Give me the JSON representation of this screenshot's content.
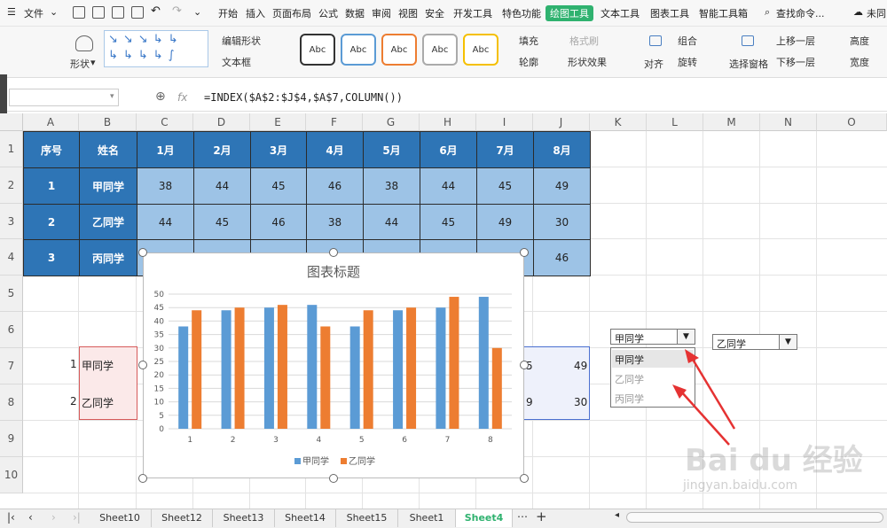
{
  "menu": {
    "file": "文件",
    "items": [
      "开始",
      "插入",
      "页面布局",
      "公式",
      "数据",
      "审阅",
      "视图",
      "安全",
      "开发工具",
      "特色功能",
      "绘图工具",
      "文本工具",
      "图表工具",
      "智能工具箱"
    ],
    "search": "查找命令...",
    "sync": "未同"
  },
  "ribbon": {
    "shape": "形状",
    "edit_shape": "编辑形状",
    "text_box": "文本框",
    "style_text": "Abc",
    "fill": "填充",
    "format_brush": "格式刷",
    "outline": "轮廓",
    "shape_effect": "形状效果",
    "align": "对齐",
    "group": "组合",
    "rotate": "旋转",
    "selection_pane": "选择窗格",
    "bring_forward": "上移一层",
    "send_backward": "下移一层",
    "height": "高度",
    "width": "宽度"
  },
  "formula_bar": {
    "fx": "fx",
    "formula": "=INDEX($A$2:$J$4,$A$7,COLUMN())"
  },
  "columns": [
    "A",
    "B",
    "C",
    "D",
    "E",
    "F",
    "G",
    "H",
    "I",
    "J",
    "K",
    "L",
    "M",
    "N",
    "O"
  ],
  "rows": [
    "1",
    "2",
    "3",
    "4",
    "5",
    "6",
    "7",
    "8",
    "9",
    "10"
  ],
  "table": {
    "headers": [
      "序号",
      "姓名",
      "1月",
      "2月",
      "3月",
      "4月",
      "5月",
      "6月",
      "7月",
      "8月"
    ],
    "rows": [
      [
        "1",
        "甲同学",
        "38",
        "44",
        "45",
        "46",
        "38",
        "44",
        "45",
        "49"
      ],
      [
        "2",
        "乙同学",
        "44",
        "45",
        "46",
        "38",
        "44",
        "45",
        "49",
        "30"
      ],
      [
        "3",
        "丙同学",
        "",
        "",
        "",
        "",
        "",
        "",
        "",
        "46"
      ]
    ]
  },
  "lower_rows": [
    {
      "idx": "1",
      "name": "甲同学",
      "partial": "5",
      "last": "49"
    },
    {
      "idx": "2",
      "name": "乙同学",
      "partial": "9",
      "last": "30"
    }
  ],
  "dropdown1": {
    "selected": "甲同学",
    "options": [
      "甲同学",
      "乙同学",
      "丙同学"
    ]
  },
  "dropdown2": {
    "selected": "乙同学"
  },
  "sheets": [
    "Sheet10",
    "Sheet12",
    "Sheet13",
    "Sheet14",
    "Sheet15",
    "Sheet1",
    "Sheet4"
  ],
  "active_sheet": "Sheet4",
  "watermark": {
    "brand": "Bai du 经验",
    "url": "jingyan.baidu.com"
  },
  "colors": {
    "header_blue": "#2e75b6",
    "cell_blue": "#9dc3e6",
    "series1": "#5b9bd5",
    "series2": "#ed7d31",
    "accent_green": "#2fb26f"
  },
  "chart_data": {
    "type": "bar",
    "title": "图表标题",
    "categories": [
      "1",
      "2",
      "3",
      "4",
      "5",
      "6",
      "7",
      "8"
    ],
    "series": [
      {
        "name": "甲同学",
        "values": [
          38,
          44,
          45,
          46,
          38,
          44,
          45,
          49
        ]
      },
      {
        "name": "乙同学",
        "values": [
          44,
          45,
          46,
          38,
          44,
          45,
          49,
          30
        ]
      }
    ],
    "ylim": [
      0,
      50
    ],
    "yticks": [
      "0",
      "5",
      "10",
      "15",
      "20",
      "25",
      "30",
      "35",
      "40",
      "45",
      "50"
    ],
    "grid": true,
    "legend": "bottom"
  }
}
